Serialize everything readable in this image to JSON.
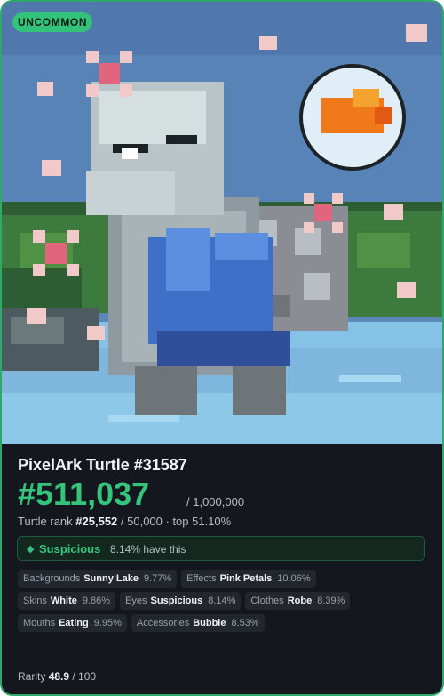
{
  "badge": "UNCOMMON",
  "card": {
    "title": "PixelArk Turtle #31587",
    "rank": "#511,037",
    "rank_total": "/ 1,000,000",
    "turtle_rank_label": "Turtle rank",
    "turtle_rank_value": "#25,552",
    "turtle_rank_rest": "/ 50,000 · top 51.10%"
  },
  "highlight": {
    "value": "Suspicious",
    "percent": "8.14% have this"
  },
  "traits": [
    {
      "category": "Backgrounds",
      "value": "Sunny Lake",
      "percent": "9.77%"
    },
    {
      "category": "Effects",
      "value": "Pink Petals",
      "percent": "10.06%"
    },
    {
      "category": "Skins",
      "value": "White",
      "percent": "9.86%"
    },
    {
      "category": "Eyes",
      "value": "Suspicious",
      "percent": "8.14%"
    },
    {
      "category": "Clothes",
      "value": "Robe",
      "percent": "8.39%"
    },
    {
      "category": "Mouths",
      "value": "Eating",
      "percent": "9.95%"
    },
    {
      "category": "Accessories",
      "value": "Bubble",
      "percent": "8.53%"
    }
  ],
  "rarity": {
    "label": "Rarity",
    "value": "48.9",
    "max": "/ 100"
  },
  "colors": {
    "accent": "#35c47b",
    "border": "#2fa86a",
    "panel": "#14171d",
    "chip": "#22262d"
  }
}
